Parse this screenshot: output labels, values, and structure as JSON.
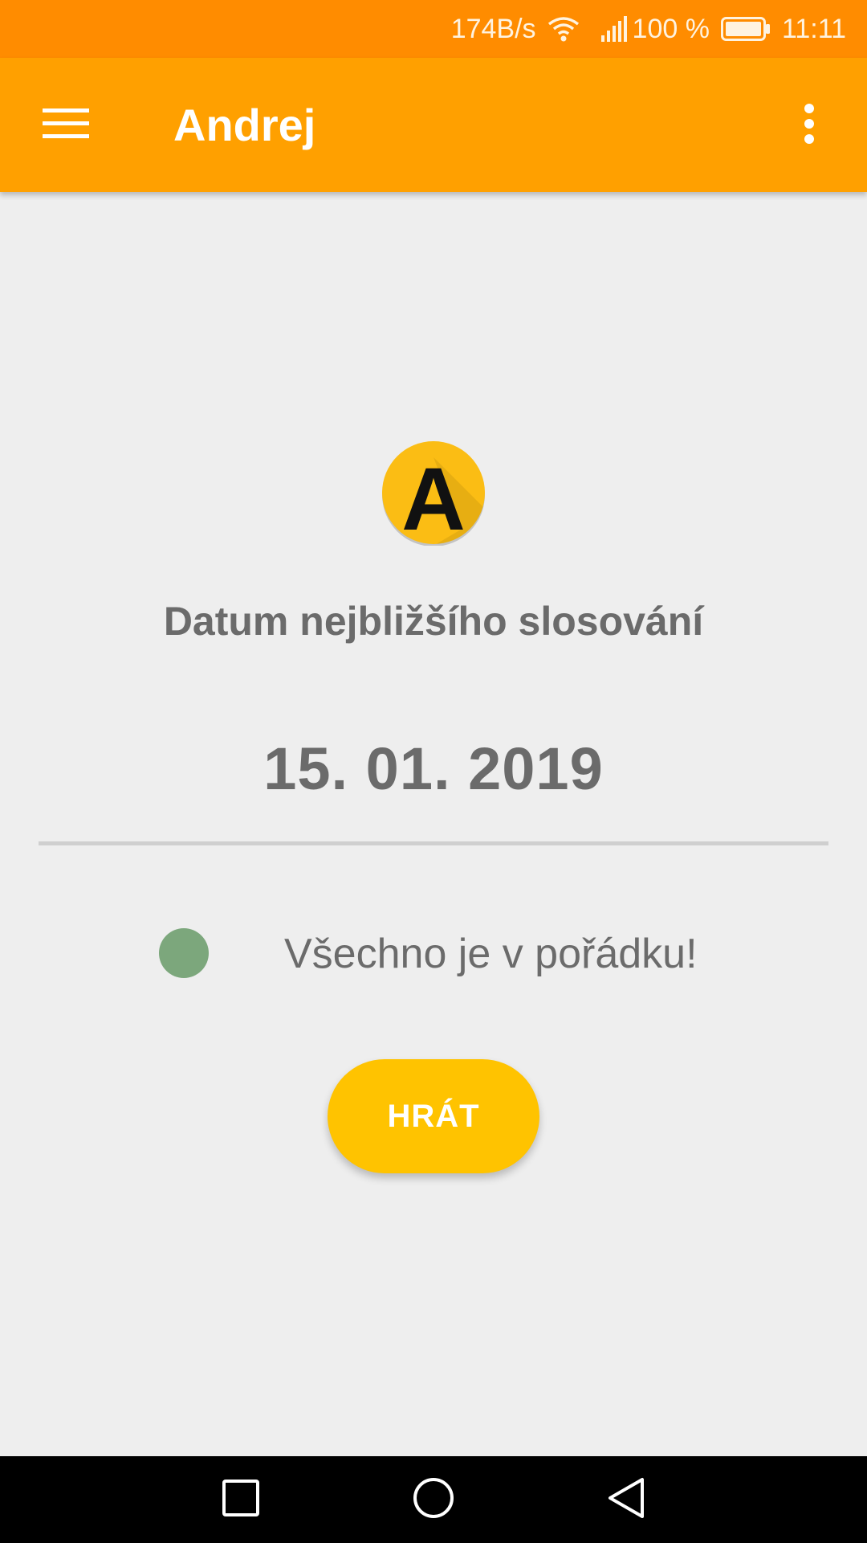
{
  "status_bar": {
    "network_speed": "174B/s",
    "battery_percent": "100 %",
    "time": "11:11",
    "icons": [
      "wifi-icon",
      "signal-icon",
      "battery-icon"
    ]
  },
  "app_bar": {
    "title": "Andrej",
    "icons": [
      "menu-icon",
      "more-vert-icon"
    ]
  },
  "main": {
    "logo_letter": "A",
    "draw_label": "Datum nejbližšího slosování",
    "draw_date": "15. 01. 2019",
    "status_text": "Všechno je v pořádku!",
    "status_color": "#7ca77c",
    "play_label": "HRÁT"
  },
  "nav_bar": {
    "icons": [
      "recent-apps-icon",
      "home-icon",
      "back-icon"
    ]
  },
  "colors": {
    "status_bar": "#ff8c00",
    "app_bar": "#ffa000",
    "accent": "#ffc300",
    "background": "#eeeeee",
    "text": "#6b6b6b"
  }
}
